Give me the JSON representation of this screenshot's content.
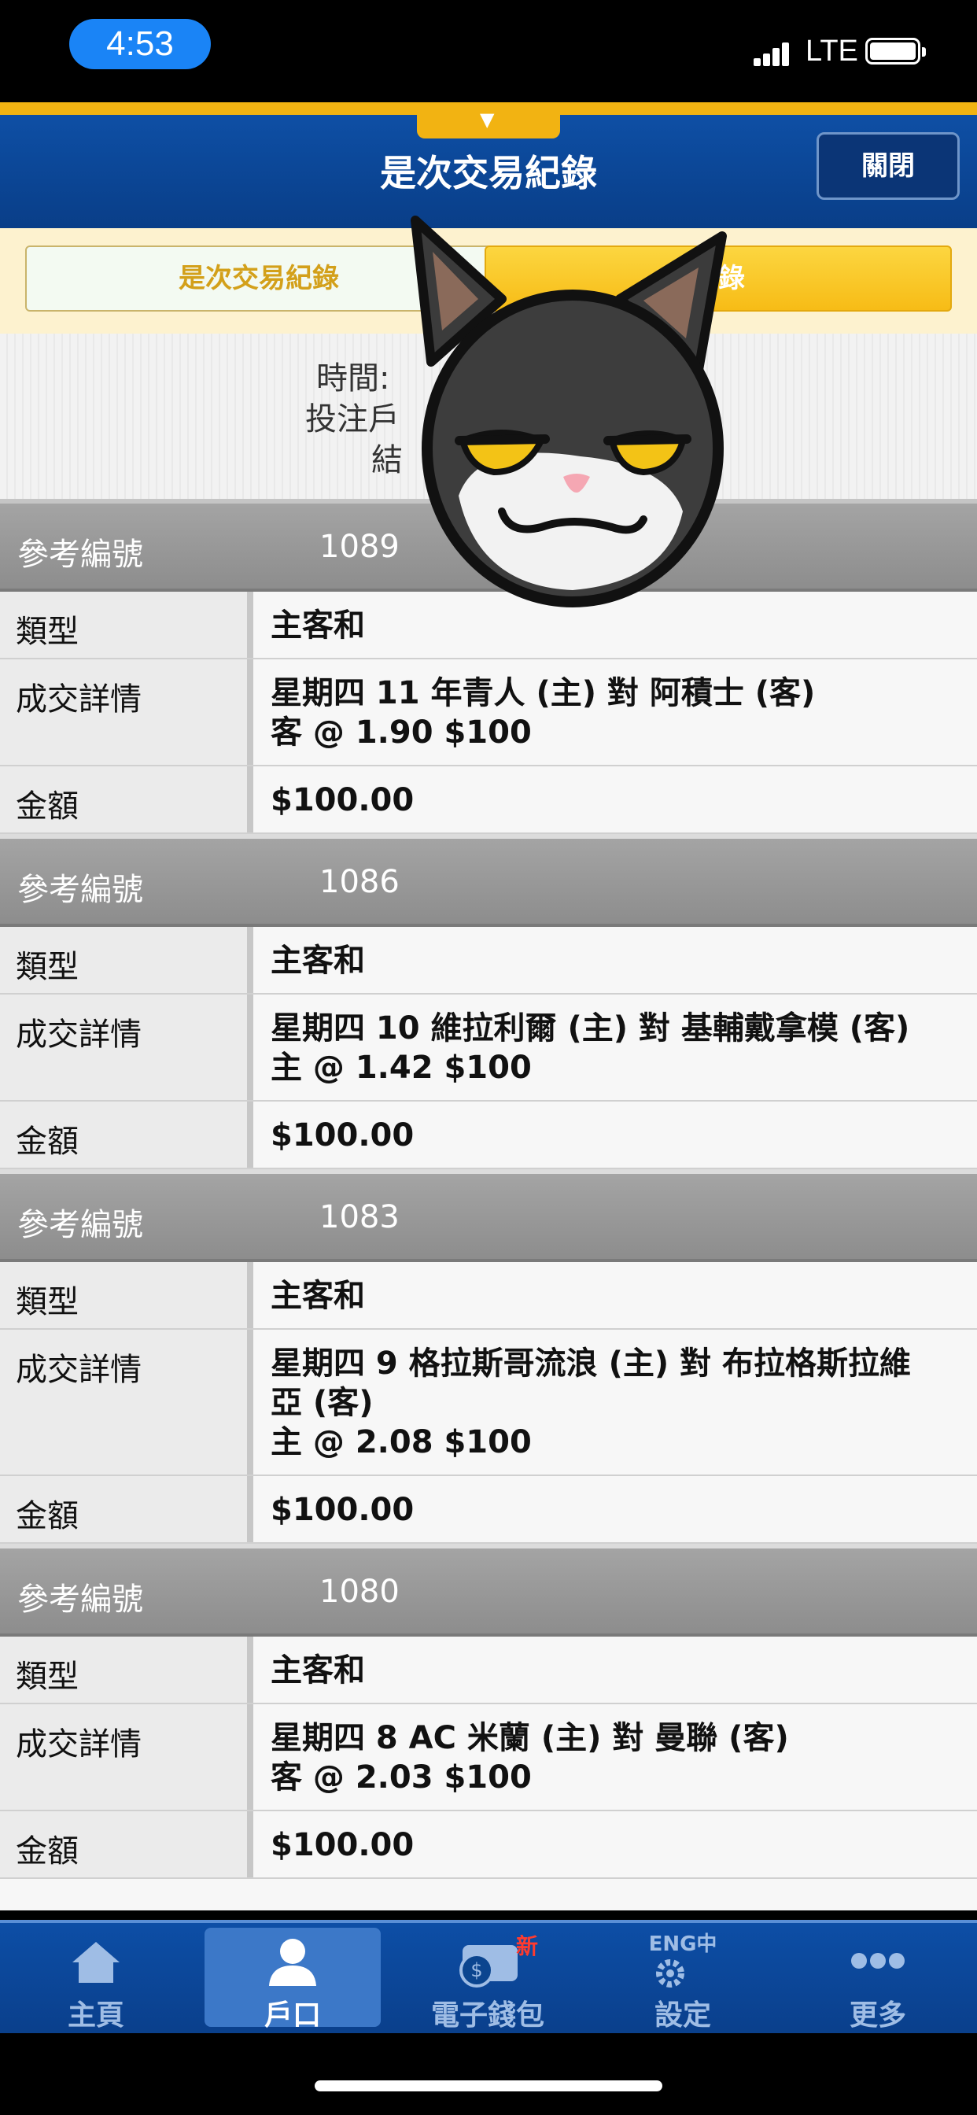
{
  "status_bar": {
    "time": "4:53",
    "network": "LTE"
  },
  "header": {
    "title": "是次交易紀錄",
    "close_label": "關閉"
  },
  "subtabs": [
    {
      "label": "是次交易紀錄"
    },
    {
      "label": "紀錄"
    }
  ],
  "info": {
    "time_label": "時間:",
    "account_label": "投注戶",
    "result_label": "結"
  },
  "row_labels": {
    "ref": "參考編號",
    "type": "類型",
    "details": "成交詳情",
    "amount": "金額"
  },
  "records": [
    {
      "ref": "1089",
      "type": "主客和",
      "details_line1": "星期四 11  年青人 (主) 對 阿積士 (客)",
      "details_line2": "客 @ 1.90 $100",
      "details_line3": "",
      "amount": "$100.00"
    },
    {
      "ref": "1086",
      "type": "主客和",
      "details_line1": "星期四 10  維拉利爾 (主) 對 基輔戴拿模 (客)",
      "details_line2": "主 @ 1.42 $100",
      "details_line3": "",
      "amount": "$100.00"
    },
    {
      "ref": "1083",
      "type": "主客和",
      "details_line1": "星期四 9  格拉斯哥流浪 (主) 對 布拉格斯拉維",
      "details_line2": "亞 (客)",
      "details_line3": "主 @ 2.08 $100",
      "amount": "$100.00"
    },
    {
      "ref": "1080",
      "type": "主客和",
      "details_line1": "星期四 8  AC 米蘭 (主) 對 曼聯 (客)",
      "details_line2": "客 @ 2.03 $100",
      "details_line3": "",
      "amount": "$100.00"
    }
  ],
  "nav": {
    "items": [
      {
        "label": "主頁",
        "icon": "home-icon"
      },
      {
        "label": "戶口",
        "icon": "account-icon"
      },
      {
        "label": "電子錢包",
        "icon": "wallet-icon",
        "badge": "新"
      },
      {
        "label": "設定",
        "icon": "settings-icon",
        "extra": "ENG中"
      },
      {
        "label": "更多",
        "icon": "more-icon"
      }
    ]
  }
}
